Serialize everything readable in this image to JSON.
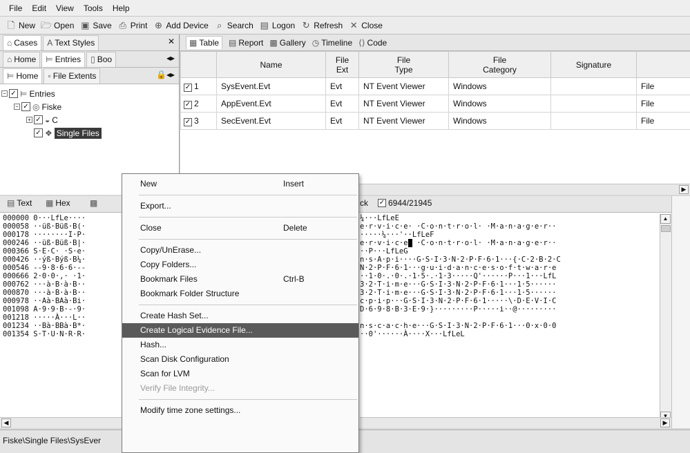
{
  "menubar": [
    "File",
    "Edit",
    "View",
    "Tools",
    "Help"
  ],
  "toolbar": [
    {
      "label": "New",
      "icon": "new-file-icon"
    },
    {
      "label": "Open",
      "icon": "open-folder-icon"
    },
    {
      "label": "Save",
      "icon": "save-icon"
    },
    {
      "label": "Print",
      "icon": "print-icon"
    },
    {
      "label": "Add Device",
      "icon": "add-device-icon"
    },
    {
      "label": "Search",
      "icon": "search-icon"
    },
    {
      "label": "Logon",
      "icon": "logon-icon"
    },
    {
      "label": "Refresh",
      "icon": "refresh-icon"
    },
    {
      "label": "Close",
      "icon": "close-icon"
    }
  ],
  "left": {
    "tabs1": [
      "Cases",
      "Text Styles"
    ],
    "tabs2": [
      "Home",
      "Entries",
      "Boo"
    ],
    "tabs3": [
      "Home",
      "File Extents"
    ],
    "tree": [
      "Entries",
      "Fiske",
      "C",
      "Single Files"
    ]
  },
  "table": {
    "tabs": [
      "Table",
      "Report",
      "Gallery",
      "Timeline",
      "Code"
    ],
    "headers": [
      "Name",
      "File\nExt",
      "File\nType",
      "File\nCategory",
      "Signature"
    ],
    "rows": [
      {
        "idx": "1",
        "name": "SysEvent.Evt",
        "ext": "Evt",
        "type": "NT Event Viewer",
        "cat": "Windows",
        "sig": "",
        "extra": "File"
      },
      {
        "idx": "2",
        "name": "AppEvent.Evt",
        "ext": "Evt",
        "type": "NT Event Viewer",
        "cat": "Windows",
        "sig": "",
        "extra": "File"
      },
      {
        "idx": "3",
        "name": "SecEvent.Evt",
        "ext": "Evt",
        "type": "NT Event Viewer",
        "cat": "Windows",
        "sig": "",
        "extra": "File"
      }
    ]
  },
  "lower": {
    "tabs": {
      "text": "Text",
      "hex": "Hex",
      "ck": "ck",
      "counter": "6944/21945"
    },
    "hex_rows": [
      "000000 0···LfLe····",
      "000058 ··üß·Büß·B(·",
      "000178 ········I·P·",
      "000246 ··üß·Büß·B|·",
      "000366 S·E·C· ·S·e·",
      "000426 ··ýß·Býß·B¼·",
      "000546 --9·8·6·6·--",
      "000666 2·0·0·,· ·1·",
      "000762 ···à·B·à·B··",
      "000870 ···à·B·à·B··",
      "000978 ··Aà·BAà·Bi·",
      "001098 A·9·9·B·-·9·",
      "001218 ·····À···L··",
      "001234 ··Bà·BBà·B*·",
      "001354 S·T·U·N·R·R·"
    ],
    "text_rows": [
      "¼···LfLeE",
      "e·r·v·i·c·e· ·C·o·n·t·r·o·l· ·M·a·n·a·g·e·r··",
      "·····¼···'··LfLeF",
      "e·r·v·i·c·e",
      "··P···LfLeG",
      "n·s·A·p·i····G·S·I·3·N·2·P·F·6·1···{·C·2·B·2·C",
      "N·2·P·F·6·1···g·u·i·d·a·n·c·e·s·o·f·t·w·a·r·e",
      "··1·0·.·0·.·1·5·.·1·3·····Q'······P···1···LfL",
      "3·2·T·i·m·e···G·S·I·3·N·2·P·F·6·1···1·5······",
      "3·2·T·i·m·e···G·S·I·3·N·2·P·F·6·1···1·5······",
      "c·p·i·p···G·S·I·3·N·2·P·F·6·1·····\\·D·E·V·I·C",
      "D·6·9·8·B·3·E·9·}·········P·····i··@·········",
      "",
      "n·s·c·a·c·h·e···G·S·I·3·N·2·P·F·6·1···0·x·0·0",
      "··0'······À····X···LfLeL"
    ],
    "cursor_row_rest": " ·C·o·n·t·r·o·l· ·M·a·n·a·g·e·r··"
  },
  "context_menu": {
    "groups": [
      [
        {
          "label": "New",
          "shortcut": "Insert"
        }
      ],
      [
        {
          "label": "Export..."
        }
      ],
      [
        {
          "label": "Close",
          "shortcut": "Delete"
        }
      ],
      [
        {
          "label": "Copy/UnErase..."
        },
        {
          "label": "Copy Folders..."
        },
        {
          "label": "Bookmark Files",
          "shortcut": "Ctrl-B"
        },
        {
          "label": "Bookmark Folder Structure"
        }
      ],
      [
        {
          "label": "Create Hash Set..."
        },
        {
          "label": "Create Logical Evidence File...",
          "highlighted": true
        },
        {
          "label": "Hash..."
        },
        {
          "label": "Scan Disk Configuration"
        },
        {
          "label": "Scan for LVM"
        },
        {
          "label": "Verify File Integrity...",
          "disabled": true
        }
      ],
      [
        {
          "label": "Modify time zone settings..."
        }
      ]
    ]
  },
  "status": "Fiske\\Single Files\\SysEver"
}
